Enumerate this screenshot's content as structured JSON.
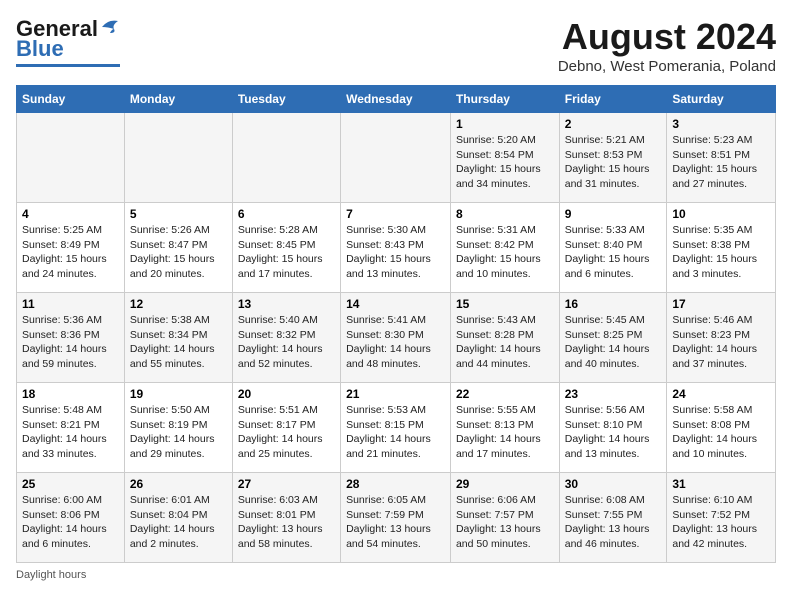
{
  "header": {
    "logo_general": "General",
    "logo_blue": "Blue",
    "month_title": "August 2024",
    "subtitle": "Debno, West Pomerania, Poland"
  },
  "days_of_week": [
    "Sunday",
    "Monday",
    "Tuesday",
    "Wednesday",
    "Thursday",
    "Friday",
    "Saturday"
  ],
  "weeks": [
    [
      {
        "day": "",
        "info": ""
      },
      {
        "day": "",
        "info": ""
      },
      {
        "day": "",
        "info": ""
      },
      {
        "day": "",
        "info": ""
      },
      {
        "day": "1",
        "info": "Sunrise: 5:20 AM\nSunset: 8:54 PM\nDaylight: 15 hours\nand 34 minutes."
      },
      {
        "day": "2",
        "info": "Sunrise: 5:21 AM\nSunset: 8:53 PM\nDaylight: 15 hours\nand 31 minutes."
      },
      {
        "day": "3",
        "info": "Sunrise: 5:23 AM\nSunset: 8:51 PM\nDaylight: 15 hours\nand 27 minutes."
      }
    ],
    [
      {
        "day": "4",
        "info": "Sunrise: 5:25 AM\nSunset: 8:49 PM\nDaylight: 15 hours\nand 24 minutes."
      },
      {
        "day": "5",
        "info": "Sunrise: 5:26 AM\nSunset: 8:47 PM\nDaylight: 15 hours\nand 20 minutes."
      },
      {
        "day": "6",
        "info": "Sunrise: 5:28 AM\nSunset: 8:45 PM\nDaylight: 15 hours\nand 17 minutes."
      },
      {
        "day": "7",
        "info": "Sunrise: 5:30 AM\nSunset: 8:43 PM\nDaylight: 15 hours\nand 13 minutes."
      },
      {
        "day": "8",
        "info": "Sunrise: 5:31 AM\nSunset: 8:42 PM\nDaylight: 15 hours\nand 10 minutes."
      },
      {
        "day": "9",
        "info": "Sunrise: 5:33 AM\nSunset: 8:40 PM\nDaylight: 15 hours\nand 6 minutes."
      },
      {
        "day": "10",
        "info": "Sunrise: 5:35 AM\nSunset: 8:38 PM\nDaylight: 15 hours\nand 3 minutes."
      }
    ],
    [
      {
        "day": "11",
        "info": "Sunrise: 5:36 AM\nSunset: 8:36 PM\nDaylight: 14 hours\nand 59 minutes."
      },
      {
        "day": "12",
        "info": "Sunrise: 5:38 AM\nSunset: 8:34 PM\nDaylight: 14 hours\nand 55 minutes."
      },
      {
        "day": "13",
        "info": "Sunrise: 5:40 AM\nSunset: 8:32 PM\nDaylight: 14 hours\nand 52 minutes."
      },
      {
        "day": "14",
        "info": "Sunrise: 5:41 AM\nSunset: 8:30 PM\nDaylight: 14 hours\nand 48 minutes."
      },
      {
        "day": "15",
        "info": "Sunrise: 5:43 AM\nSunset: 8:28 PM\nDaylight: 14 hours\nand 44 minutes."
      },
      {
        "day": "16",
        "info": "Sunrise: 5:45 AM\nSunset: 8:25 PM\nDaylight: 14 hours\nand 40 minutes."
      },
      {
        "day": "17",
        "info": "Sunrise: 5:46 AM\nSunset: 8:23 PM\nDaylight: 14 hours\nand 37 minutes."
      }
    ],
    [
      {
        "day": "18",
        "info": "Sunrise: 5:48 AM\nSunset: 8:21 PM\nDaylight: 14 hours\nand 33 minutes."
      },
      {
        "day": "19",
        "info": "Sunrise: 5:50 AM\nSunset: 8:19 PM\nDaylight: 14 hours\nand 29 minutes."
      },
      {
        "day": "20",
        "info": "Sunrise: 5:51 AM\nSunset: 8:17 PM\nDaylight: 14 hours\nand 25 minutes."
      },
      {
        "day": "21",
        "info": "Sunrise: 5:53 AM\nSunset: 8:15 PM\nDaylight: 14 hours\nand 21 minutes."
      },
      {
        "day": "22",
        "info": "Sunrise: 5:55 AM\nSunset: 8:13 PM\nDaylight: 14 hours\nand 17 minutes."
      },
      {
        "day": "23",
        "info": "Sunrise: 5:56 AM\nSunset: 8:10 PM\nDaylight: 14 hours\nand 13 minutes."
      },
      {
        "day": "24",
        "info": "Sunrise: 5:58 AM\nSunset: 8:08 PM\nDaylight: 14 hours\nand 10 minutes."
      }
    ],
    [
      {
        "day": "25",
        "info": "Sunrise: 6:00 AM\nSunset: 8:06 PM\nDaylight: 14 hours\nand 6 minutes."
      },
      {
        "day": "26",
        "info": "Sunrise: 6:01 AM\nSunset: 8:04 PM\nDaylight: 14 hours\nand 2 minutes."
      },
      {
        "day": "27",
        "info": "Sunrise: 6:03 AM\nSunset: 8:01 PM\nDaylight: 13 hours\nand 58 minutes."
      },
      {
        "day": "28",
        "info": "Sunrise: 6:05 AM\nSunset: 7:59 PM\nDaylight: 13 hours\nand 54 minutes."
      },
      {
        "day": "29",
        "info": "Sunrise: 6:06 AM\nSunset: 7:57 PM\nDaylight: 13 hours\nand 50 minutes."
      },
      {
        "day": "30",
        "info": "Sunrise: 6:08 AM\nSunset: 7:55 PM\nDaylight: 13 hours\nand 46 minutes."
      },
      {
        "day": "31",
        "info": "Sunrise: 6:10 AM\nSunset: 7:52 PM\nDaylight: 13 hours\nand 42 minutes."
      }
    ]
  ],
  "footer": {
    "note": "Daylight hours"
  }
}
